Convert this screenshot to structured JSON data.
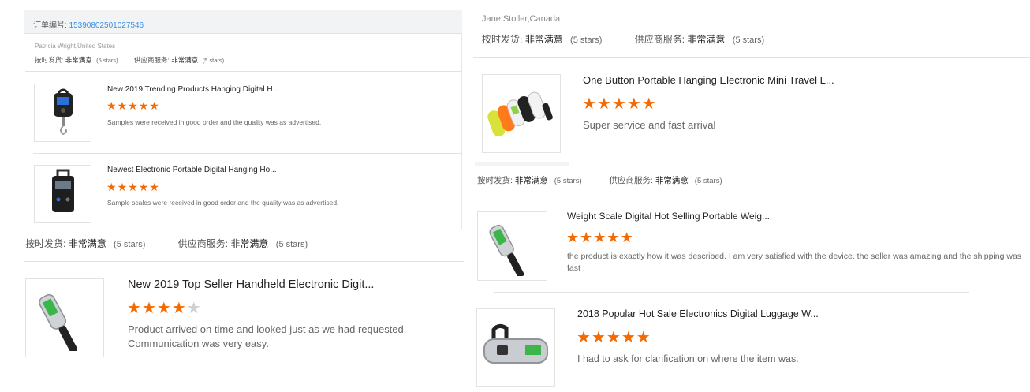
{
  "colors": {
    "star": "#f56a00",
    "star_off": "#cfcfcf",
    "link": "#3a8ee6",
    "divider": "#e2e2e2"
  },
  "panel_a": {
    "order_label": "订单编号:",
    "order_number": "15390802501027546",
    "buyer": "Patricia Wright,United States",
    "ratings": {
      "ship_label": "按时发货:",
      "ship_value": "非常满意",
      "ship_stars": "(5 stars)",
      "service_label": "供应商服务:",
      "service_value": "非常满意",
      "service_stars": "(5 stars)"
    },
    "items": [
      {
        "title": "New 2019 Trending Products Hanging Digital H...",
        "rating": 5,
        "review": "Samples were received in good order and the quality was as advertised.",
        "icon": "hanging-scale-icon"
      },
      {
        "title": "Newest Electronic Portable Digital Hanging Ho...",
        "rating": 5,
        "review": "Sample scales were received in good order and the quality was as advertised.",
        "icon": "hanging-scale-icon"
      }
    ]
  },
  "panel_b": {
    "ratings": {
      "ship_label": "按时发货:",
      "ship_value": "非常满意",
      "ship_stars": "(5 stars)",
      "service_label": "供应商服务:",
      "service_value": "非常满意",
      "service_stars": "(5 stars)"
    },
    "item": {
      "title": "New 2019 Top Seller Handheld Electronic Digit...",
      "rating": 4,
      "review": "Product arrived on time and looked just as we had requested. Communication was very easy.",
      "icon": "luggage-scale-icon"
    }
  },
  "panel_c": {
    "buyer": "Jane Stoller,Canada",
    "ratings": {
      "ship_label": "按时发货:",
      "ship_value": "非常满意",
      "ship_stars": "(5 stars)",
      "service_label": "供应商服务:",
      "service_value": "非常满意",
      "service_stars": "(5 stars)"
    },
    "item": {
      "title": "One Button Portable Hanging Electronic Mini Travel L...",
      "rating": 5,
      "review": "Super service and fast arrival",
      "icon": "colorful-scales-icon"
    }
  },
  "panel_d": {
    "ratings": {
      "ship_label": "按时发货:",
      "ship_value": "非常满意",
      "ship_stars": "(5 stars)",
      "service_label": "供应商服务:",
      "service_value": "非常满意",
      "service_stars": "(5 stars)"
    },
    "items": [
      {
        "title": "Weight Scale Digital Hot Selling Portable Weig...",
        "rating": 5,
        "review": "the product is exactly how it was described. I am very satisfied with the device.  the seller was amazing and the shipping was fast .",
        "icon": "luggage-scale-icon"
      },
      {
        "title": "2018 Popular Hot Sale Electronics Digital Luggage W...",
        "rating": 5,
        "review": "I had to ask for clarification  on where the item was.",
        "icon": "silver-scale-icon"
      }
    ]
  }
}
